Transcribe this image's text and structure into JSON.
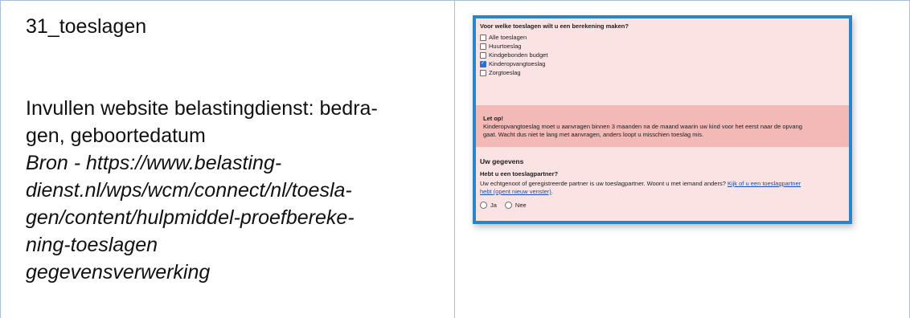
{
  "left": {
    "title": "31_toeslagen",
    "description_lines": [
      "Invullen website belastingdienst: bedra-",
      "gen, geboortedatum"
    ],
    "source_lines": [
      "Bron -  https://www.belasting-",
      "dienst.nl/wps/wcm/connect/nl/toesla-",
      "gen/content/hulpmiddel-proefbereke-",
      "ning-toeslagen",
      "gegevensverwerking"
    ]
  },
  "screenshot": {
    "question": "Voor welke toeslagen wilt u een berekening maken?",
    "options": [
      {
        "label": "Alle toeslagen",
        "checked": false
      },
      {
        "label": "Huurtoeslag",
        "checked": false
      },
      {
        "label": "Kindgebonden budget",
        "checked": false
      },
      {
        "label": "Kinderopvangtoeslag",
        "checked": true
      },
      {
        "label": "Zorgtoeslag",
        "checked": false
      }
    ],
    "alert": {
      "title": "Let op!",
      "body": "Kinderopvangtoeslag moet u aanvragen binnen 3 maanden na de maand waarin uw kind voor het eerst naar de opvang gaat. Wacht dus niet te lang met aanvragen, anders loopt u misschien toeslag mis."
    },
    "section_title": "Uw gegevens",
    "partner_question": "Hebt u een toeslagpartner?",
    "partner_text": "Uw echtgenoot of geregistreerde partner is uw toeslagpartner. Woont u met iemand anders?",
    "partner_link": "Kijk of u een toeslagpartner hebt (opent nieuw venster)",
    "partner_text_end": ".",
    "radio_yes": "Ja",
    "radio_no": "Nee"
  }
}
